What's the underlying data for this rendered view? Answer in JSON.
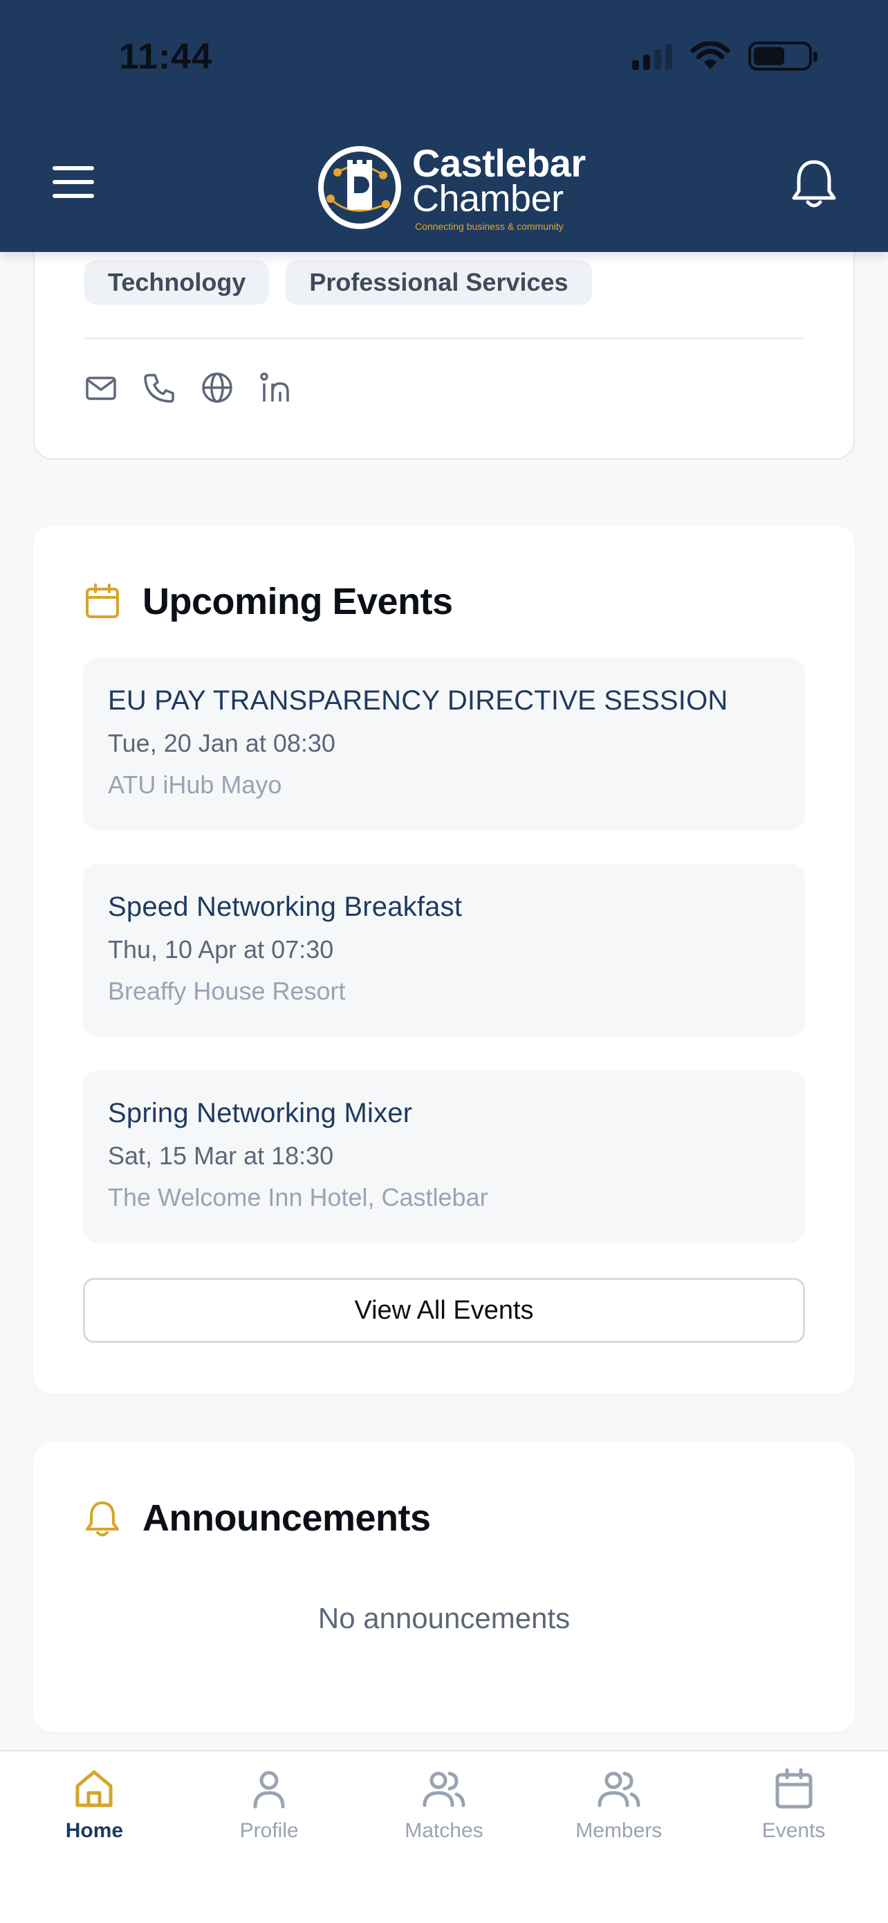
{
  "status_bar": {
    "time": "11:44"
  },
  "header": {
    "logo_line1": "Castlebar",
    "logo_line2": "Chamber",
    "logo_tagline": "Connecting business & community"
  },
  "profile_card": {
    "tags": [
      "Technology",
      "Professional Services"
    ],
    "contact_icons": [
      "mail-icon",
      "phone-icon",
      "globe-icon",
      "linkedin-icon"
    ]
  },
  "upcoming_events": {
    "title": "Upcoming Events",
    "events": [
      {
        "title": "EU PAY TRANSPARENCY DIRECTIVE SESSION",
        "date": "Tue, 20 Jan at 08:30",
        "location": "ATU iHub Mayo"
      },
      {
        "title": "Speed Networking Breakfast",
        "date": "Thu, 10 Apr at 07:30",
        "location": "Breaffy House Resort"
      },
      {
        "title": "Spring Networking Mixer",
        "date": "Sat, 15 Mar at 18:30",
        "location": "The Welcome Inn Hotel, Castlebar"
      }
    ],
    "view_all_label": "View All Events"
  },
  "announcements": {
    "title": "Announcements",
    "empty_text": "No announcements"
  },
  "bottom_nav": {
    "items": [
      {
        "label": "Home",
        "icon": "home-icon",
        "active": true
      },
      {
        "label": "Profile",
        "icon": "user-icon",
        "active": false
      },
      {
        "label": "Matches",
        "icon": "users-icon",
        "active": false
      },
      {
        "label": "Members",
        "icon": "users-icon",
        "active": false
      },
      {
        "label": "Events",
        "icon": "calendar-icon",
        "active": false
      }
    ]
  },
  "colors": {
    "header_bg": "#1e3a5f",
    "accent_gold": "#d4a52a",
    "nav_active": "#1e3a5f",
    "nav_inactive": "#9aa3b2"
  }
}
